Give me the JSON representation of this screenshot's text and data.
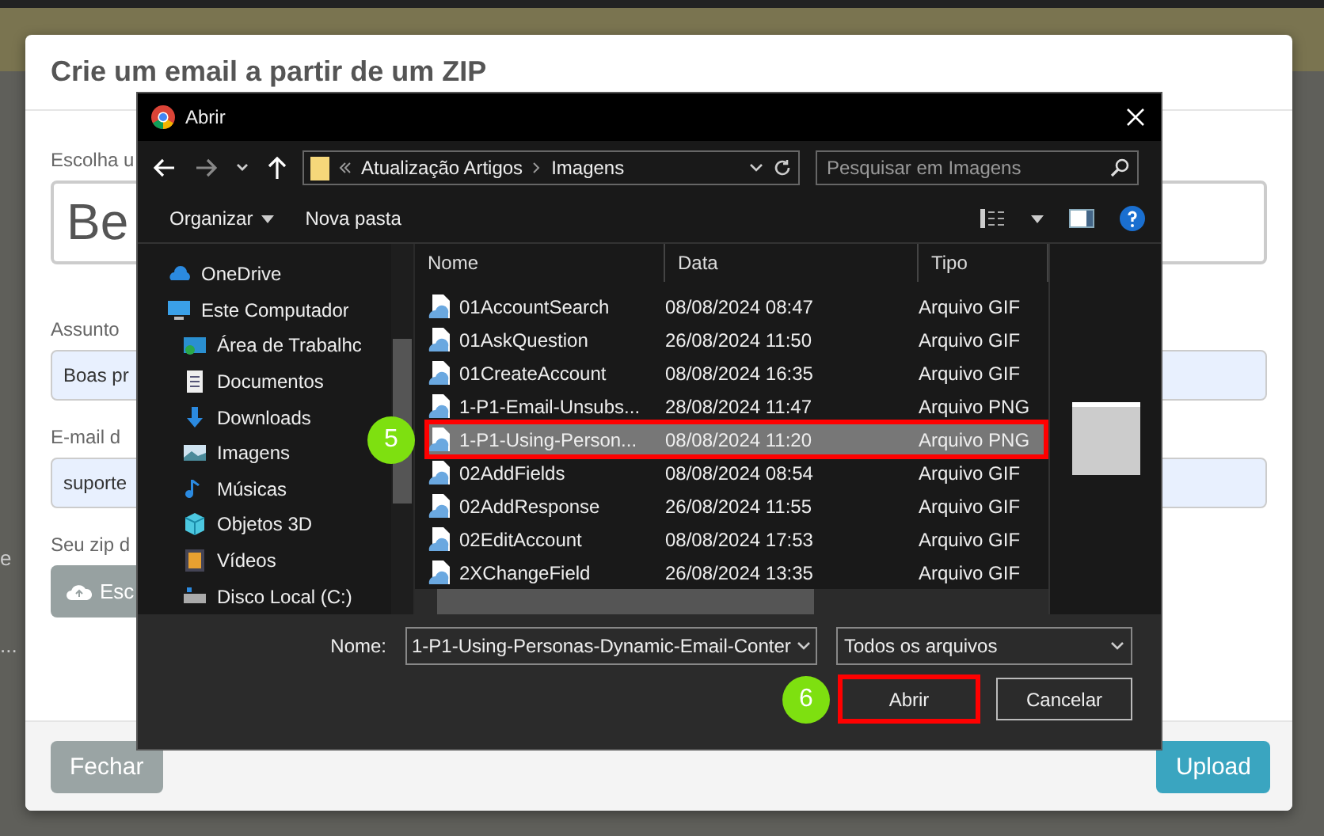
{
  "page_fragments": [
    "e",
    "..."
  ],
  "background_modal": {
    "title": "Crie um email a partir de um ZIP",
    "fields": [
      {
        "label": "Escolha u",
        "value": "Be",
        "kind": "large"
      },
      {
        "label": "Assunto",
        "value": "Boas pr",
        "kind": "input"
      },
      {
        "label": "E-mail d",
        "value": "suporte",
        "kind": "input"
      },
      {
        "label": "Seu zip d",
        "value": "Esc",
        "kind": "upload"
      }
    ],
    "buttons": [
      {
        "label": "Fechar",
        "kind": "secondary"
      },
      {
        "label": "Upload",
        "kind": "primary"
      }
    ]
  },
  "dialog": {
    "title": "Abrir",
    "breadcrumb": [
      "Atualização Artigos",
      "Imagens"
    ],
    "search": {
      "placeholder": "Pesquisar em Imagens"
    },
    "toolbar": [
      {
        "label": "Organizar",
        "kind": "menu"
      },
      {
        "label": "Nova pasta",
        "kind": "button"
      }
    ],
    "nav_items": [
      {
        "label": "OneDrive",
        "kind": "cloud"
      },
      {
        "label": "Este Computador",
        "kind": "computer",
        "children": [
          {
            "label": "Área de Trabalhc",
            "kind": "desktop"
          },
          {
            "label": "Documentos",
            "kind": "documents"
          },
          {
            "label": "Downloads",
            "kind": "downloads"
          },
          {
            "label": "Imagens",
            "kind": "pictures"
          },
          {
            "label": "Músicas",
            "kind": "music"
          },
          {
            "label": "Objetos 3D",
            "kind": "objects"
          },
          {
            "label": "Vídeos",
            "kind": "videos"
          },
          {
            "label": "Disco Local (C:)",
            "kind": "drive"
          }
        ]
      }
    ],
    "columns": [
      "Nome",
      "Data",
      "Tipo"
    ],
    "files": [
      {
        "name": "01AccountSearch",
        "date": "08/08/2024 08:47",
        "type": "Arquivo GIF",
        "selected": false
      },
      {
        "name": "01AskQuestion",
        "date": "26/08/2024 11:50",
        "type": "Arquivo GIF",
        "selected": false
      },
      {
        "name": "01CreateAccount",
        "date": "08/08/2024 16:35",
        "type": "Arquivo GIF",
        "selected": false
      },
      {
        "name": "1-P1-Email-Unsubs...",
        "date": "28/08/2024 11:47",
        "type": "Arquivo PNG",
        "selected": false
      },
      {
        "name": "1-P1-Using-Person...",
        "date": "08/08/2024 11:20",
        "type": "Arquivo PNG",
        "selected": true,
        "callout": "5"
      },
      {
        "name": "02AddFields",
        "date": "08/08/2024 08:54",
        "type": "Arquivo GIF",
        "selected": false
      },
      {
        "name": "02AddResponse",
        "date": "26/08/2024 11:55",
        "type": "Arquivo GIF",
        "selected": false
      },
      {
        "name": "02EditAccount",
        "date": "08/08/2024 17:53",
        "type": "Arquivo GIF",
        "selected": false
      },
      {
        "name": "2XChangeField",
        "date": "26/08/2024 13:35",
        "type": "Arquivo GIF",
        "selected": false
      }
    ],
    "filename_label": "Nome:",
    "filename": "1-P1-Using-Personas-Dynamic-Email-Conter",
    "filter": "Todos os arquivos",
    "buttons": [
      {
        "label": "Abrir",
        "callout": "6"
      },
      {
        "label": "Cancelar"
      }
    ]
  }
}
